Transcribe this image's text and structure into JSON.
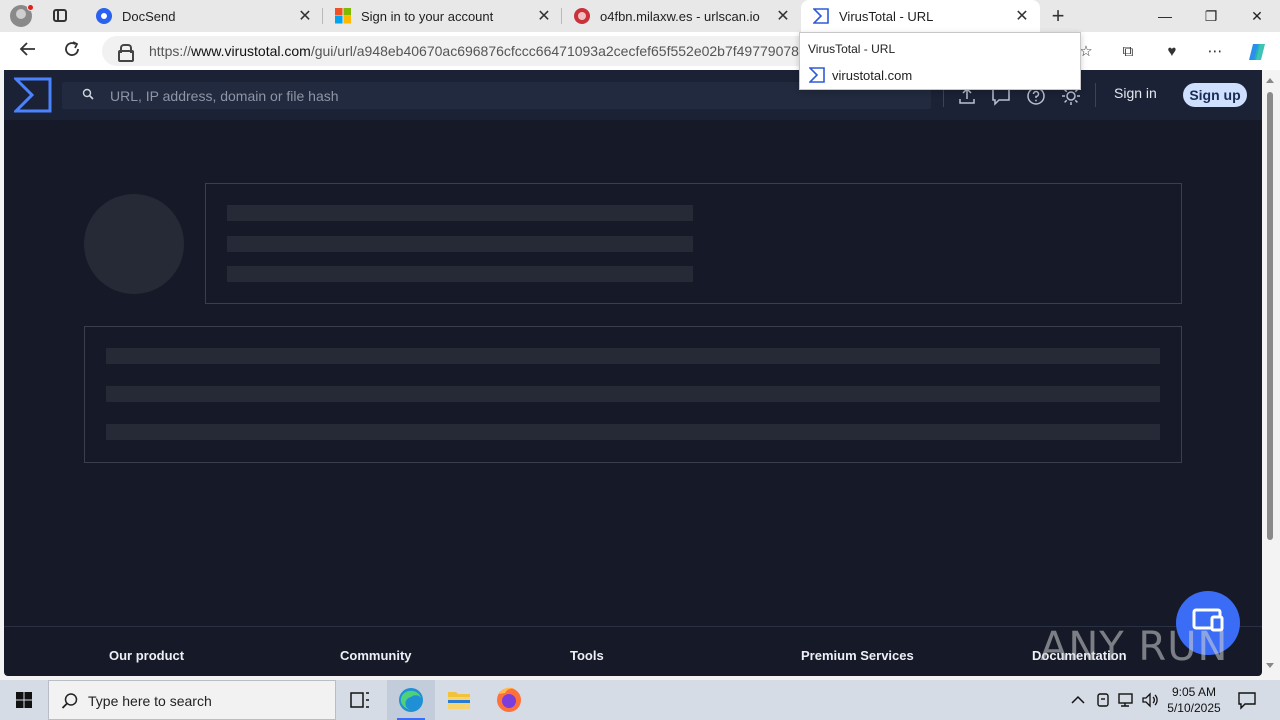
{
  "browser": {
    "tabs": [
      {
        "title": "DocSend",
        "icon": "docsend-icon"
      },
      {
        "title": "Sign in to your account",
        "icon": "microsoft-icon"
      },
      {
        "title": "o4fbn.milaxw.es - urlscan.io",
        "icon": "urlscan-icon"
      },
      {
        "title": "VirusTotal - URL",
        "icon": "virustotal-icon",
        "active": true
      }
    ],
    "new_tab_label": "+",
    "url_host_prefix": "https://",
    "url_host": "www.virustotal.com",
    "url_path": "/gui/url/a948eb40670ac696876cfccc66471093a2cecfef65f552e02b7f49779078",
    "tooltip": {
      "title": "VirusTotal - URL",
      "domain": "virustotal.com"
    }
  },
  "virustotal": {
    "search_placeholder": "URL, IP address, domain or file hash",
    "sign_in": "Sign in",
    "sign_up": "Sign up",
    "footer": [
      "Our product",
      "Community",
      "Tools",
      "Premium Services",
      "Documentation"
    ],
    "colors": {
      "background": "#161a28",
      "header": "#1b2236",
      "accent": "#3b6cf6",
      "signup_bg": "#cfe0ff"
    }
  },
  "watermark": {
    "text": "ANY RUN"
  },
  "taskbar": {
    "search_placeholder": "Type here to search",
    "time": "9:05 AM",
    "date": "5/10/2025"
  }
}
